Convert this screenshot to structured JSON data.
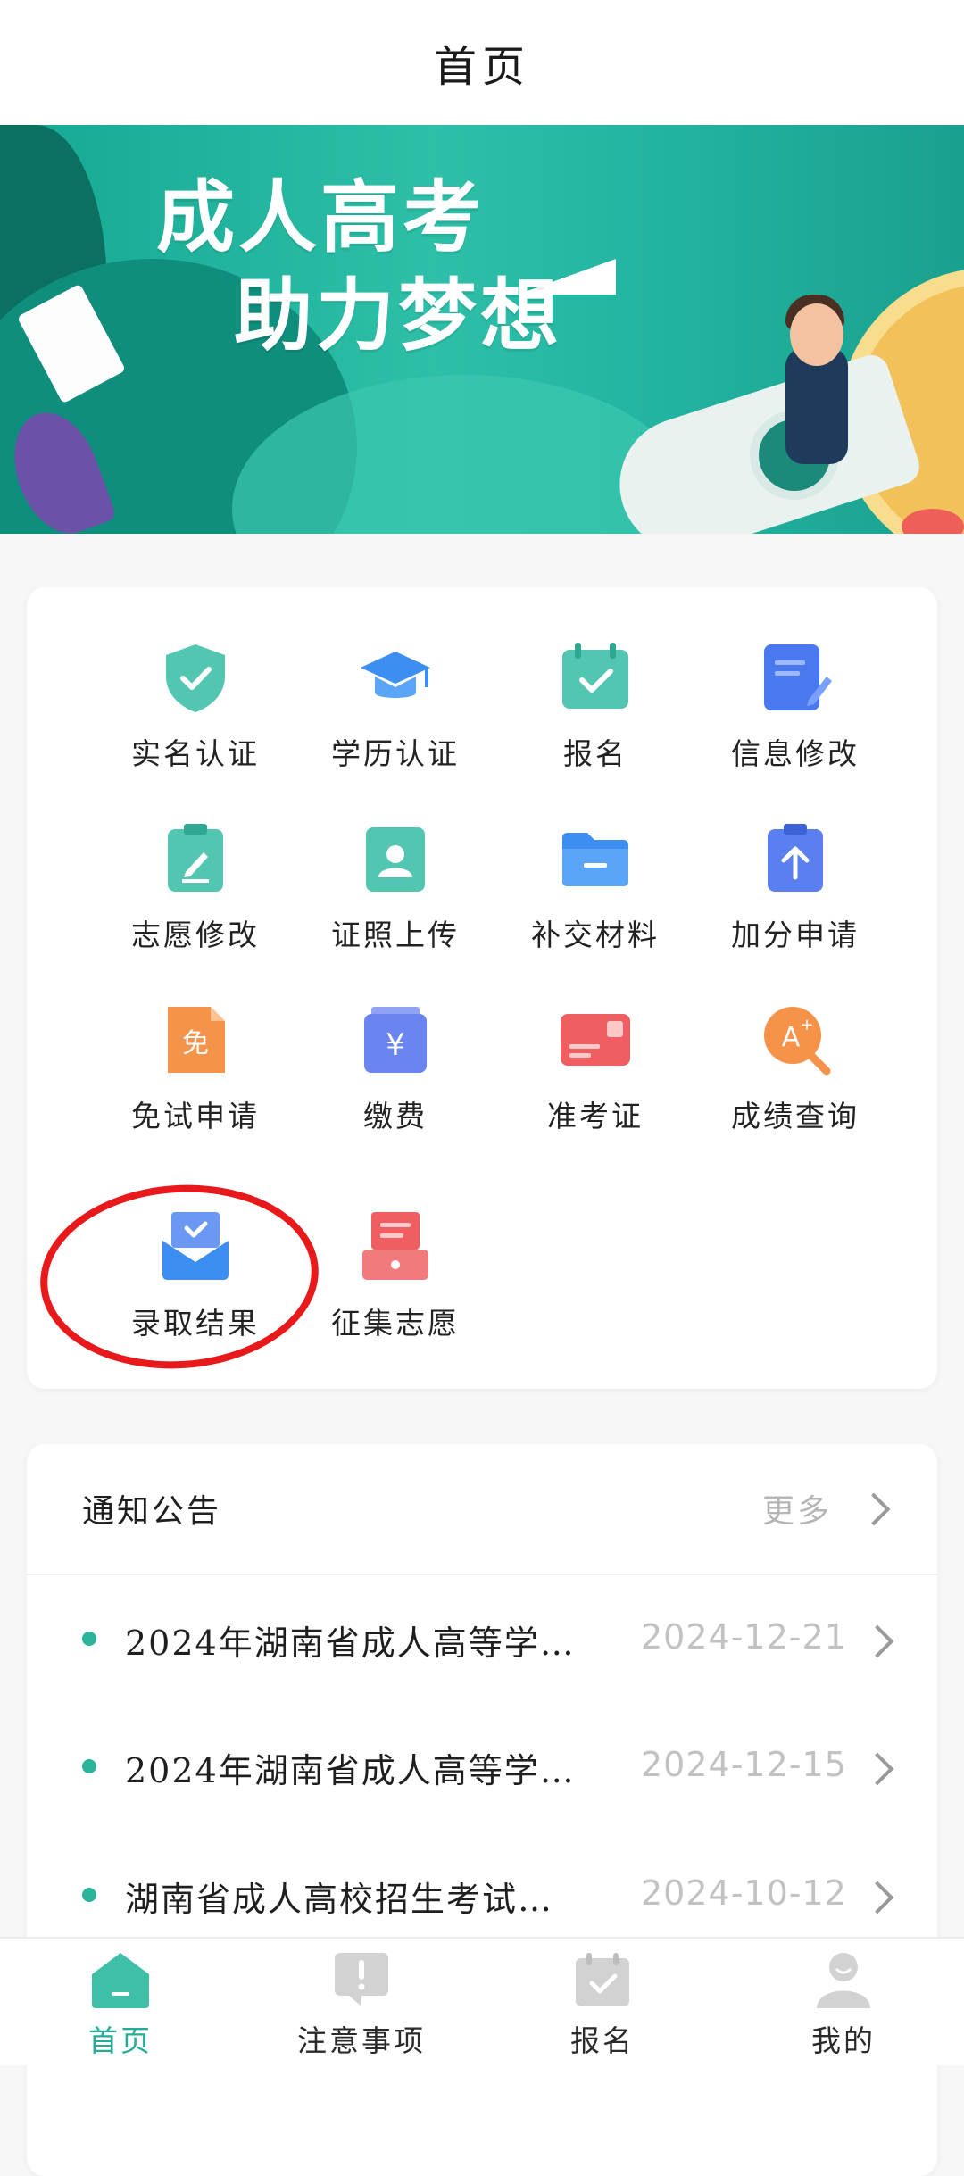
{
  "header": {
    "title": "首页"
  },
  "banner": {
    "line1": "成人高考",
    "line2": "助力梦想"
  },
  "services": [
    {
      "label": "实名认证",
      "icon": "shield-check-icon"
    },
    {
      "label": "学历认证",
      "icon": "graduation-cap-icon"
    },
    {
      "label": "报名",
      "icon": "calendar-check-icon"
    },
    {
      "label": "信息修改",
      "icon": "document-edit-icon"
    },
    {
      "label": "志愿修改",
      "icon": "clipboard-edit-icon"
    },
    {
      "label": "证照上传",
      "icon": "id-photo-icon"
    },
    {
      "label": "补交材料",
      "icon": "folder-icon"
    },
    {
      "label": "加分申请",
      "icon": "clipboard-upload-icon"
    },
    {
      "label": "免试申请",
      "icon": "exempt-document-icon"
    },
    {
      "label": "缴费",
      "icon": "yuan-payment-icon"
    },
    {
      "label": "准考证",
      "icon": "admission-ticket-icon"
    },
    {
      "label": "成绩查询",
      "icon": "score-search-icon"
    },
    {
      "label": "录取结果",
      "icon": "admission-envelope-icon"
    },
    {
      "label": "征集志愿",
      "icon": "collection-box-icon"
    }
  ],
  "notices": {
    "title": "通知公告",
    "more": "更多",
    "items": [
      {
        "text": "2024年湖南省成人高等学…",
        "date": "2024-12-21"
      },
      {
        "text": "2024年湖南省成人高等学…",
        "date": "2024-12-15"
      },
      {
        "text": "湖南省成人高校招生考试…",
        "date": "2024-10-12"
      }
    ]
  },
  "tabs": [
    {
      "label": "首页",
      "icon": "home-icon",
      "active": true
    },
    {
      "label": "注意事项",
      "icon": "notice-icon",
      "active": false
    },
    {
      "label": "报名",
      "icon": "register-icon",
      "active": false
    },
    {
      "label": "我的",
      "icon": "profile-icon",
      "active": false
    }
  ],
  "colors": {
    "accent": "#26ad98",
    "annotation": "#e8191b"
  }
}
